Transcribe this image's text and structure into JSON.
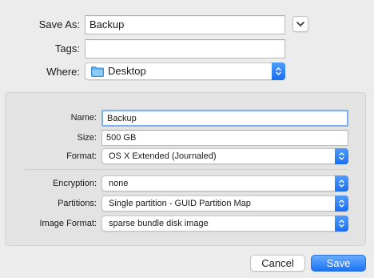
{
  "save_as": {
    "label": "Save As:",
    "value": "Backup"
  },
  "tags": {
    "label": "Tags:",
    "value": ""
  },
  "where": {
    "label": "Where:",
    "value": "Desktop",
    "icon": "folder-icon"
  },
  "image": {
    "name": {
      "label": "Name:",
      "value": "Backup"
    },
    "size": {
      "label": "Size:",
      "value": "500 GB"
    },
    "format": {
      "label": "Format:",
      "value": "OS X Extended (Journaled)"
    },
    "encryption": {
      "label": "Encryption:",
      "value": "none"
    },
    "partitions": {
      "label": "Partitions:",
      "value": "Single partition - GUID Partition Map"
    },
    "image_format": {
      "label": "Image Format:",
      "value": "sparse bundle disk image"
    }
  },
  "buttons": {
    "cancel": "Cancel",
    "save": "Save"
  },
  "colors": {
    "accent": "#1b73f4",
    "panel": "#e3e3e3",
    "window": "#ececec"
  }
}
